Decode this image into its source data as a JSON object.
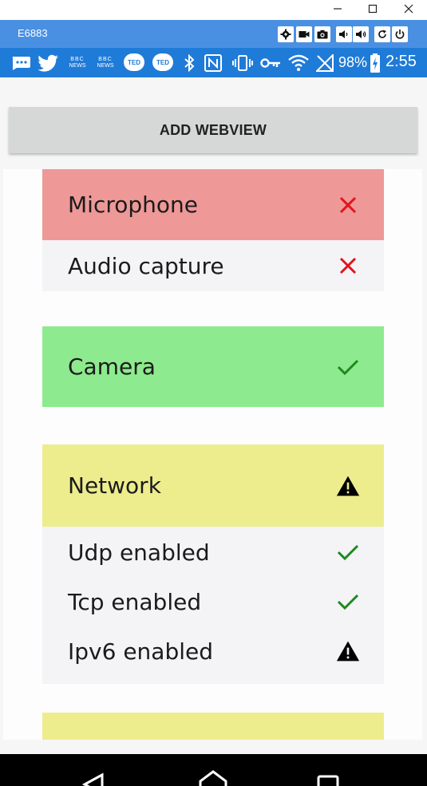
{
  "window": {
    "minimize_icon": "minimize-icon",
    "maximize_icon": "maximize-icon",
    "close_icon": "close-icon"
  },
  "emulator": {
    "title": "E6883",
    "buttons": [
      "settings-icon",
      "camera-video-icon",
      "screenshot-icon",
      "volume-down-icon",
      "volume-up-icon",
      "rotate-icon",
      "power-icon"
    ]
  },
  "status_bar": {
    "battery_percent": "98%",
    "time": "2:55",
    "bbc_label_top": "BBC",
    "bbc_label_bottom": "NEWS",
    "ted_label": "TED"
  },
  "app": {
    "add_webview_label": "ADD WEBVIEW",
    "sections": [
      {
        "title": "Microphone",
        "status": "error",
        "color": "#ee9898",
        "rows": [
          {
            "label": "Audio capture",
            "status": "error"
          }
        ]
      },
      {
        "title": "Camera",
        "status": "ok",
        "color": "#8eea8e",
        "rows": []
      },
      {
        "title": "Network",
        "status": "warning",
        "color": "#eded8e",
        "rows": [
          {
            "label": "Udp enabled",
            "status": "ok"
          },
          {
            "label": "Tcp enabled",
            "status": "ok"
          },
          {
            "label": "Ipv6 enabled",
            "status": "warning"
          }
        ]
      }
    ],
    "partial_section_color": "#eded8e"
  },
  "colors": {
    "emulator_bar": "#4a90e2",
    "status_bar": "#1f7bd8",
    "error": "#e3131b",
    "ok": "#1c8a1c",
    "warning": "#000000"
  }
}
